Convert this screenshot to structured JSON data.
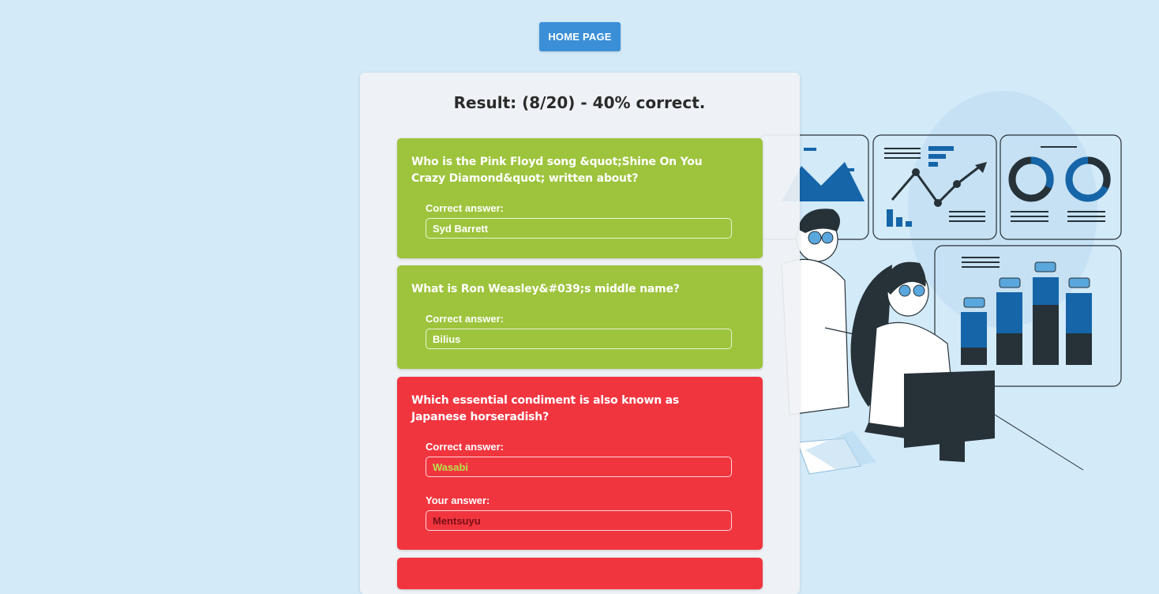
{
  "nav": {
    "home_label": "HOME PAGE"
  },
  "result": {
    "title": "Result: (8/20) - 40% correct."
  },
  "labels": {
    "correct": "Correct answer:",
    "yours": "Your answer:"
  },
  "questions": [
    {
      "text": "Who is the Pink Floyd song &quot;Shine On You Crazy Diamond&quot; written about?",
      "correct_answer": "Syd Barrett",
      "status": "correct"
    },
    {
      "text": "What is Ron Weasley&#039;s middle name?",
      "correct_answer": "Bilius",
      "status": "correct"
    },
    {
      "text": "Which essential condiment is also known as Japanese horseradish?",
      "correct_answer": "Wasabi",
      "your_answer": "Mentsuyu",
      "status": "wrong"
    }
  ],
  "colors": {
    "background": "#d3eaf9",
    "button": "#3a8fd6",
    "correct_card": "#9dc43c",
    "wrong_card": "#f1353f"
  },
  "icons": [
    "data-analytics-illustration"
  ]
}
